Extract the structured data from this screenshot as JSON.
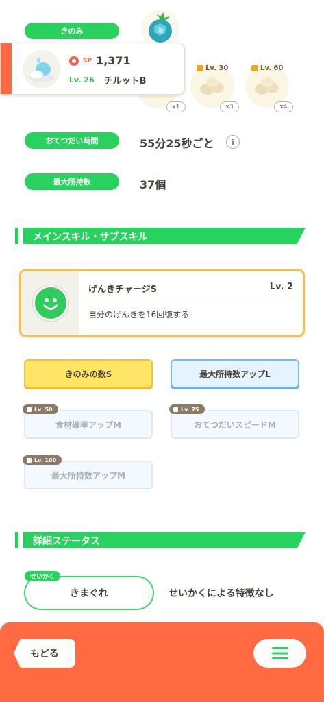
{
  "berry": {
    "label": "きのみ",
    "icon": "berry-icon"
  },
  "pokemon": {
    "sp_label": "SP",
    "sp_value": "1,371",
    "level": "Lv. 26",
    "name": "チルットB"
  },
  "ingredients": [
    {
      "level": "",
      "count": "x1"
    },
    {
      "level": "Lv. 30",
      "count": "x3"
    },
    {
      "level": "Lv. 60",
      "count": "x4"
    }
  ],
  "stats": {
    "help_time_label": "おてつだい時間",
    "help_time_value": "55分25秒ごと",
    "max_carry_label": "最大所持数",
    "max_carry_value": "37個"
  },
  "skills_section": {
    "title": "メインスキル・サブスキル",
    "main_skill": {
      "name": "げんきチャージS",
      "level": "Lv. 2",
      "description": "自分のげんきを16回復する"
    },
    "sub_skills": [
      {
        "name": "きのみの数S",
        "tag": ""
      },
      {
        "name": "最大所持数アップL",
        "tag": ""
      },
      {
        "name": "食材確率アップM",
        "tag": "Lv. 50"
      },
      {
        "name": "おてつだいスピードM",
        "tag": "Lv. 75"
      },
      {
        "name": "最大所持数アップM",
        "tag": "Lv. 100"
      }
    ]
  },
  "details_section": {
    "title": "詳細ステータス",
    "nature_tag": "せいかく",
    "nature_value": "きまぐれ",
    "nature_desc": "せいかくによる特徴なし"
  },
  "footer": {
    "back_label": "もどる",
    "menu_icon": "hamburger-menu-icon"
  },
  "colors": {
    "accent_green": "#29d15f",
    "footer_orange": "#ff6a43",
    "skill_border_yellow": "#f1c148"
  }
}
